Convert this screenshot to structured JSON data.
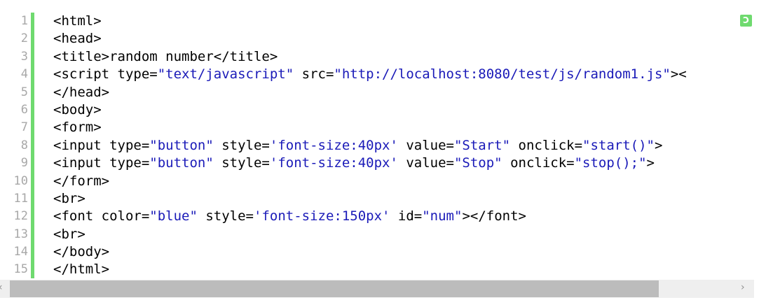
{
  "gutter": {
    "line_numbers": [
      "1",
      "2",
      "3",
      "4",
      "5",
      "6",
      "7",
      "8",
      "9",
      "10",
      "11",
      "12",
      "13",
      "14",
      "15"
    ]
  },
  "code_lines": [
    [
      {
        "t": "<html>",
        "c": "p"
      }
    ],
    [
      {
        "t": "<head>",
        "c": "p"
      }
    ],
    [
      {
        "t": "<title>random number</title>",
        "c": "p"
      }
    ],
    [
      {
        "t": "<script type=",
        "c": "p"
      },
      {
        "t": "\"text/javascript\"",
        "c": "s"
      },
      {
        "t": " src=",
        "c": "p"
      },
      {
        "t": "\"http://localhost:8080/test/js/random1.js\"",
        "c": "s"
      },
      {
        "t": "><",
        "c": "p"
      }
    ],
    [
      {
        "t": "</head>",
        "c": "p"
      }
    ],
    [
      {
        "t": "<body>",
        "c": "p"
      }
    ],
    [
      {
        "t": "<form>",
        "c": "p"
      }
    ],
    [
      {
        "t": "<input type=",
        "c": "p"
      },
      {
        "t": "\"button\"",
        "c": "s"
      },
      {
        "t": " style=",
        "c": "p"
      },
      {
        "t": "'font-size:40px'",
        "c": "s"
      },
      {
        "t": " value=",
        "c": "p"
      },
      {
        "t": "\"Start\"",
        "c": "s"
      },
      {
        "t": " onclick=",
        "c": "p"
      },
      {
        "t": "\"start()\"",
        "c": "s"
      },
      {
        "t": ">",
        "c": "p"
      }
    ],
    [
      {
        "t": "<input type=",
        "c": "p"
      },
      {
        "t": "\"button\"",
        "c": "s"
      },
      {
        "t": " style=",
        "c": "p"
      },
      {
        "t": "'font-size:40px'",
        "c": "s"
      },
      {
        "t": " value=",
        "c": "p"
      },
      {
        "t": "\"Stop\"",
        "c": "s"
      },
      {
        "t": " onclick=",
        "c": "p"
      },
      {
        "t": "\"stop();\"",
        "c": "s"
      },
      {
        "t": ">",
        "c": "p"
      }
    ],
    [
      {
        "t": "</form>",
        "c": "p"
      }
    ],
    [
      {
        "t": "<br>",
        "c": "p"
      }
    ],
    [
      {
        "t": "<font color=",
        "c": "p"
      },
      {
        "t": "\"blue\"",
        "c": "s"
      },
      {
        "t": " style=",
        "c": "p"
      },
      {
        "t": "'font-size:150px'",
        "c": "s"
      },
      {
        "t": " id=",
        "c": "p"
      },
      {
        "t": "\"num\"",
        "c": "s"
      },
      {
        "t": "></font>",
        "c": "p"
      }
    ],
    [
      {
        "t": "<br>",
        "c": "p"
      }
    ],
    [
      {
        "t": "</body>",
        "c": "p"
      }
    ],
    [
      {
        "t": "</html>",
        "c": "p"
      }
    ]
  ],
  "toolbar": {
    "copy_icon": "copy-code-icon",
    "copy_glyph": "Ↄ"
  },
  "scrollbar": {
    "left_arrow": "‹",
    "right_arrow": "›",
    "left_icon": "chevron-left-icon",
    "right_icon": "chevron-right-icon"
  },
  "colors": {
    "plain_text": "#000000",
    "string_literal": "#1a1ab8",
    "line_number": "#a8a8a8",
    "gutter_accent": "#6fda6f",
    "scrollbar_track": "#efefef",
    "scrollbar_thumb": "#bcbcbc"
  }
}
